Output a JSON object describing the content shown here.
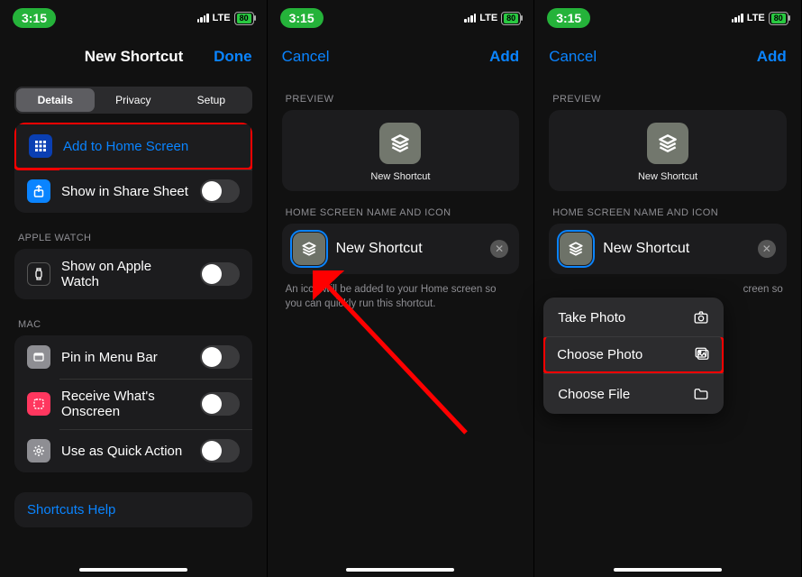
{
  "status": {
    "time": "3:15",
    "network": "LTE",
    "battery": "80"
  },
  "screen1": {
    "nav": {
      "title": "New Shortcut",
      "done": "Done"
    },
    "tabs": [
      "Details",
      "Privacy",
      "Setup"
    ],
    "active_tab": 0,
    "group_main": {
      "add_home": "Add to Home Screen",
      "share_sheet": "Show in Share Sheet"
    },
    "group_watch": {
      "header": "APPLE WATCH",
      "item": "Show on Apple Watch"
    },
    "group_mac": {
      "header": "MAC",
      "items": [
        "Pin in Menu Bar",
        "Receive What's Onscreen",
        "Use as Quick Action"
      ]
    },
    "help": "Shortcuts Help"
  },
  "screen2": {
    "nav": {
      "cancel": "Cancel",
      "add": "Add"
    },
    "preview_header": "PREVIEW",
    "preview_label": "New Shortcut",
    "section_header": "HOME SCREEN NAME AND ICON",
    "name_value": "New Shortcut",
    "hint": "An icon will be added to your Home screen so you can quickly run this shortcut."
  },
  "screen3": {
    "nav": {
      "cancel": "Cancel",
      "add": "Add"
    },
    "preview_header": "PREVIEW",
    "preview_label": "New Shortcut",
    "section_header": "HOME SCREEN NAME AND ICON",
    "name_value": "New Shortcut",
    "hint_fragment": "creen so",
    "popup": {
      "take_photo": "Take Photo",
      "choose_photo": "Choose Photo",
      "choose_file": "Choose File"
    }
  }
}
